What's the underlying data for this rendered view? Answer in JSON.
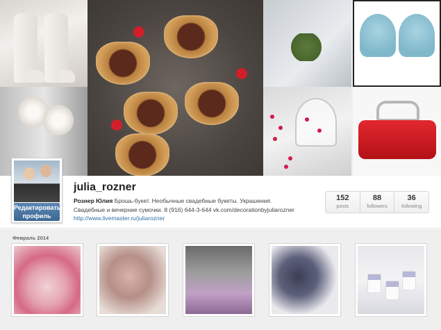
{
  "profile": {
    "username": "julia_rozner",
    "full_name": "Рознер Юлия",
    "bio_line1": " Брошь-букет. Необычные свадебные букеты. Украшения.",
    "bio_line2": "Свадебные и вечерние сумочки. 8 (916) 644-3-644 vk.com/decorationbyjuliarozner",
    "website": "http://www.livemaster.ru/juliarozner",
    "edit_button": "Редактировать профиль"
  },
  "stats": [
    {
      "value": "152",
      "label": "posts"
    },
    {
      "value": "88",
      "label": "followers"
    },
    {
      "value": "36",
      "label": "following"
    }
  ],
  "feed": {
    "month_label": "Февраль 2014"
  },
  "header_photos": [
    "white-boots",
    "strawberry-heart-pastries",
    "green-wreath-tag",
    "blue-beaded-cups",
    "white-fabric-flowers",
    "pomegranate-glass",
    "red-clutch-bag"
  ],
  "feed_photos": [
    "pink-cake",
    "fabric-brooch-bouquet",
    "champagne-bucket",
    "navy-brooch-bouquet",
    "panna-cotta-desserts"
  ]
}
